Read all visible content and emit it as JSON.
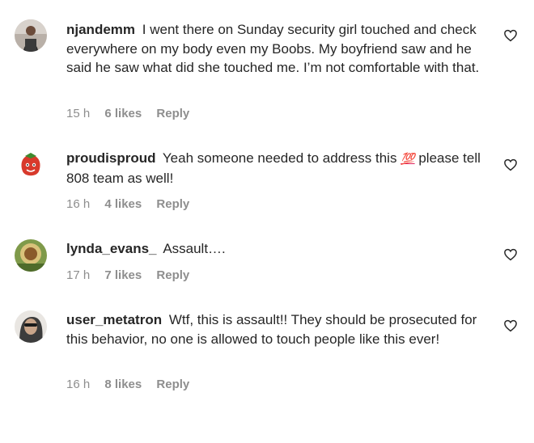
{
  "comments": [
    {
      "username": "njandemm",
      "text": "I went there on Sunday security girl touched and check everywhere on my body even my Boobs. My boyfriend saw and he said he saw what did she touched me. I’m not comfortable with that.",
      "time": "15 h",
      "likes": "6 likes",
      "reply": "Reply",
      "avatar_icon": "profile-photo-person"
    },
    {
      "username": "proudisproud",
      "text": "Yeah someone needed to address this",
      "emoji": "💯",
      "text_after": "please tell 808 team as well!",
      "time": "16 h",
      "likes": "4 likes",
      "reply": "Reply",
      "avatar_icon": "profile-photo-strawberry"
    },
    {
      "username": "lynda_evans_",
      "text": "Assault….",
      "time": "17 h",
      "likes": "7 likes",
      "reply": "Reply",
      "avatar_icon": "profile-photo-flower"
    },
    {
      "username": "user_metatron",
      "text": "Wtf, this is assault!! They should be prosecuted for this behavior, no one is allowed to touch people like this ever!",
      "time": "16 h",
      "likes": "8 likes",
      "reply": "Reply",
      "avatar_icon": "profile-photo-person-sunglasses"
    }
  ],
  "icons": {
    "like": "heart-outline-icon"
  },
  "colors": {
    "text": "#262626",
    "meta": "#8e8e8e",
    "emoji": "#e0245e"
  }
}
